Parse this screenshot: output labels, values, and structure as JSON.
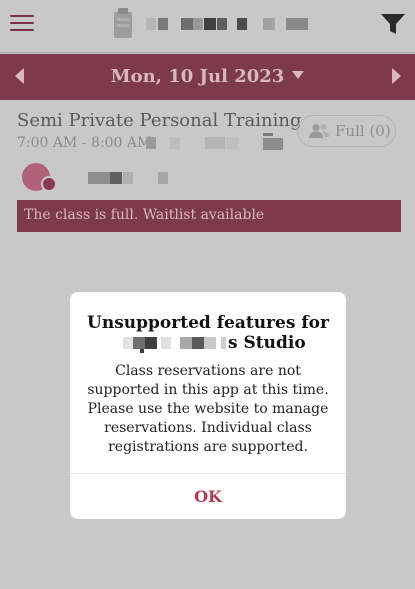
{
  "header": {
    "menu_icon": "hamburger-menu-icon",
    "logo_icon": "studio-logo-icon",
    "filter_icon": "filter-funnel-icon"
  },
  "date_nav": {
    "label": "Mon, 10 Jul 2023",
    "prev_icon": "chevron-left-icon",
    "next_icon": "chevron-right-icon",
    "caret_icon": "caret-down-icon"
  },
  "class_item": {
    "title": "Semi Private Personal Training",
    "time": "7:00 AM - 8:00 AM",
    "full_button": "Full (0)",
    "waitlist_text": "The class is full. Waitlist available"
  },
  "modal": {
    "title": "Unsupported features for",
    "subtitle_suffix": "s Studio",
    "body": "Class reservations are not supported in this app at this time. Please use the website to manage reservations. Individual class registrations are supported.",
    "ok_label": "OK"
  },
  "colors": {
    "accent": "#7d3a4e",
    "ok_text": "#b23a55",
    "overlay": "#c8c8c8"
  }
}
